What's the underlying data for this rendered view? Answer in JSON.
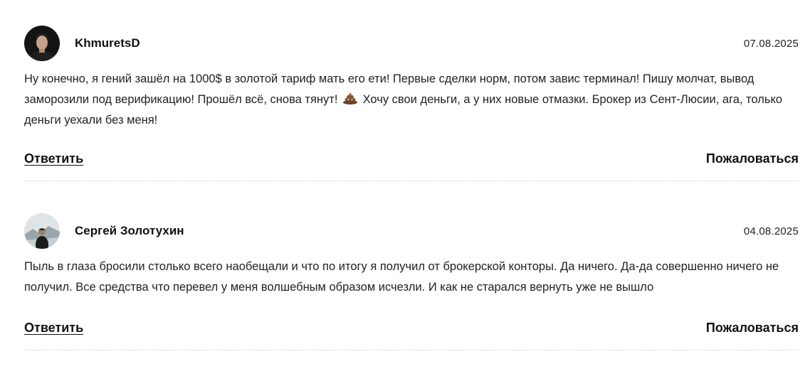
{
  "comments": [
    {
      "author": "KhmuretsD",
      "date": "07.08.2025",
      "text_before_emoji": "Ну конечно, я гений зашёл на 1000$ в золотой тариф мать его ети! Первые сделки норм, потом завис терминал! Пишу молчат, вывод заморозили под верификацию! Прошёл всё, снова тянут!",
      "emoji": "poop-icon",
      "text_after_emoji": "Хочу свои деньги, а у них новые отмазки. Брокер из Сент-Люсии, ага, только деньги уехали без меня!",
      "reply_label": "Ответить",
      "complain_label": "Пожаловаться"
    },
    {
      "author": "Сергей Золотухин",
      "date": "04.08.2025",
      "text": "Пыль в глаза бросили столько всего наобещали и что по итогу я получил от брокерской конторы. Да ничего. Да-да совершенно ничего не получил. Все средства что перевел у меня волшебным образом исчезли. И как не старался вернуть уже не вышло",
      "reply_label": "Ответить",
      "complain_label": "Пожаловаться"
    }
  ]
}
